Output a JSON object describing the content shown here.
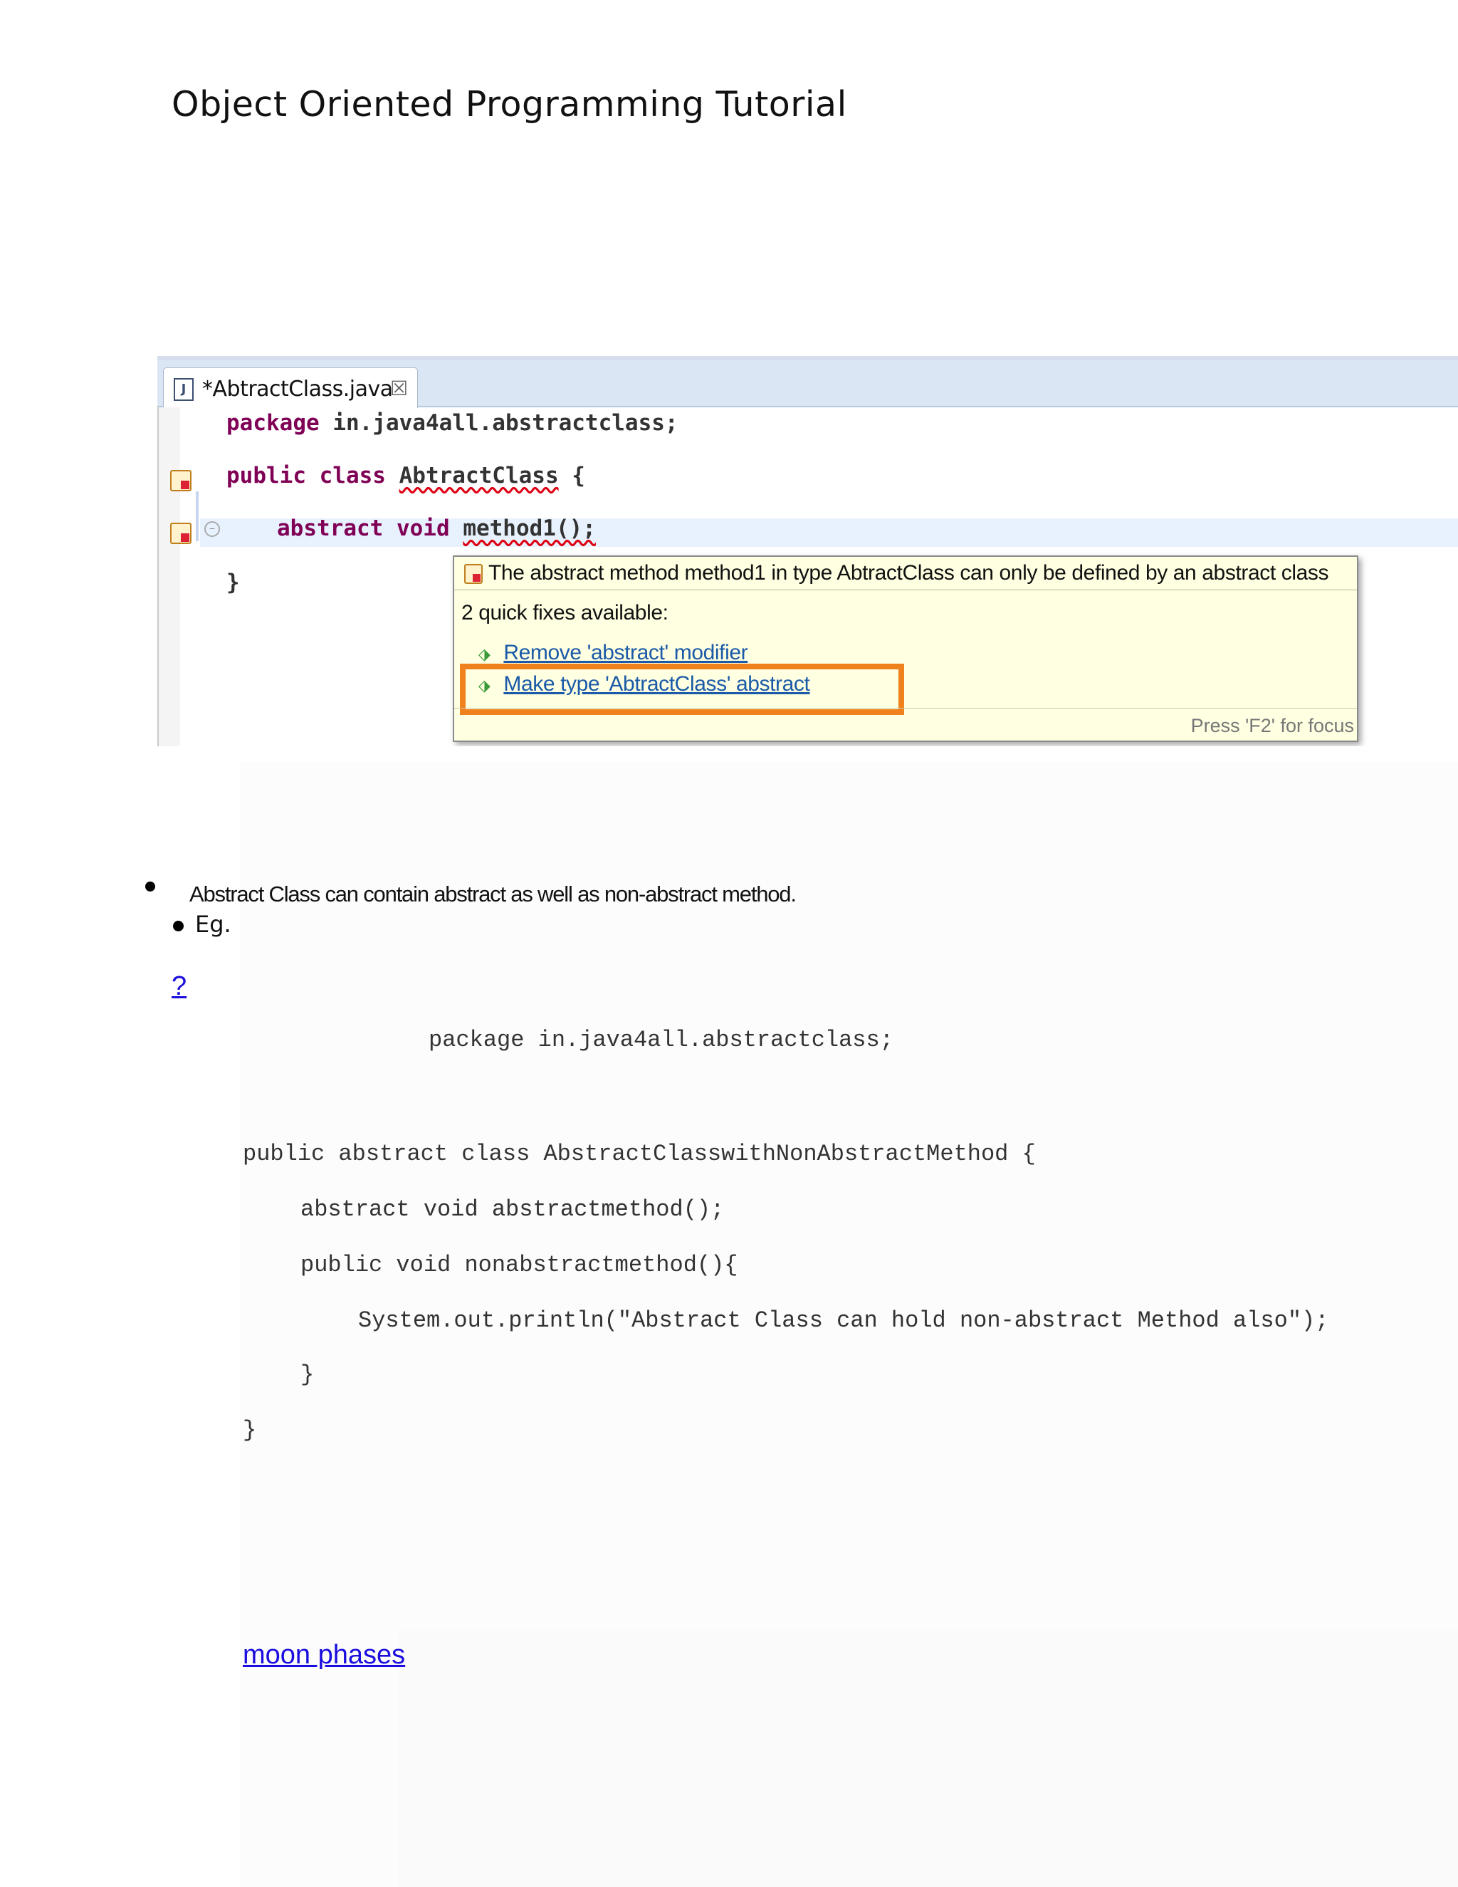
{
  "document": {
    "title": "Object Oriented Programming Tutorial"
  },
  "ide": {
    "tab_label": "*AbtractClass.java",
    "tab_close_glyph": "☒",
    "file_icon_glyph": "J",
    "code": {
      "line1_kw": "package",
      "line1_rest": " in.java4all.abstractclass;",
      "line2_kw": "public class",
      "line2_name": "AbtractClass",
      "line2_rest": " {",
      "line3_kw": "abstract void",
      "line3_name": "method1();",
      "line4": "}"
    },
    "tooltip": {
      "message": "The abstract method method1 in type AbtractClass can only be defined by an abstract class",
      "quick_fixes": "2 quick fixes available:",
      "fix1": "Remove 'abstract' modifier",
      "fix2": "Make type 'AbtractClass' abstract",
      "focus_hint": "Press 'F2' for focus"
    }
  },
  "bullets": [
    "Abstract Class can contain abstract as well as non-abstract method.",
    "Eg."
  ],
  "question_link": "?",
  "code_sample": [
    "package in.java4all.abstractclass;",
    "public abstract class AbstractClasswithNonAbstractMethod {",
    "abstract void abstractmethod();",
    "public void nonabstractmethod(){",
    "System.out.println(\"Abstract Class can hold non-abstract Method also\");",
    "}",
    "}"
  ],
  "footer_link": "moon phases"
}
